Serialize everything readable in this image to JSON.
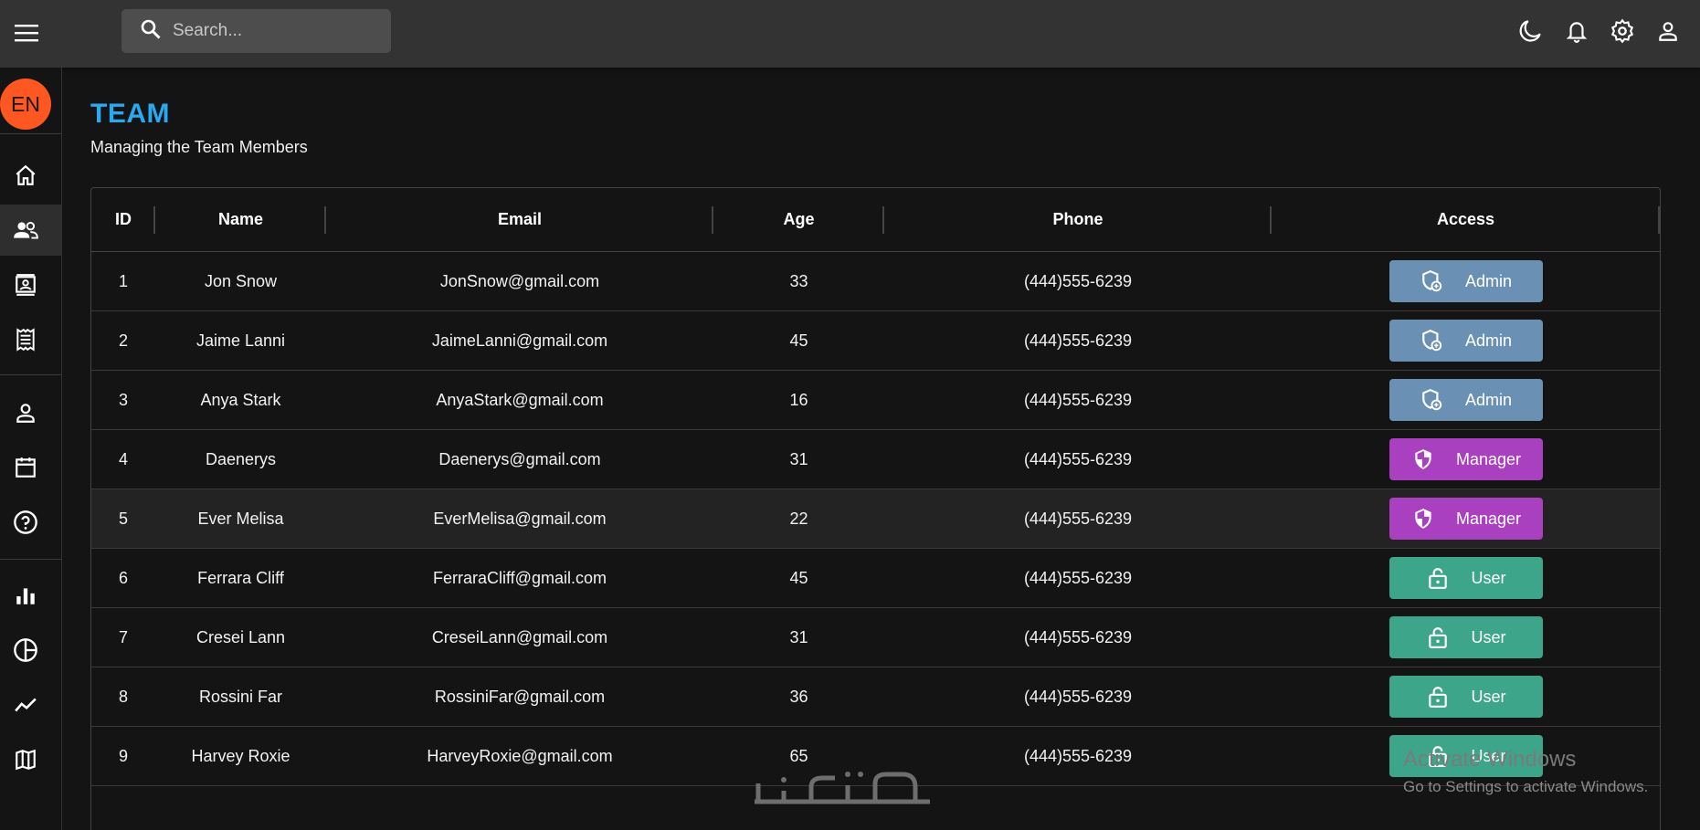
{
  "search": {
    "placeholder": "Search..."
  },
  "sidebar": {
    "language_badge": "EN"
  },
  "page": {
    "title": "TEAM",
    "subtitle": "Managing the Team Members"
  },
  "table": {
    "columns": [
      "ID",
      "Name",
      "Email",
      "Age",
      "Phone",
      "Access"
    ],
    "rows": [
      {
        "id": "1",
        "name": "Jon Snow",
        "email": "JonSnow@gmail.com",
        "age": "33",
        "phone": "(444)555-6239",
        "access": "Admin"
      },
      {
        "id": "2",
        "name": "Jaime Lanni",
        "email": "JaimeLanni@gmail.com",
        "age": "45",
        "phone": "(444)555-6239",
        "access": "Admin"
      },
      {
        "id": "3",
        "name": "Anya Stark",
        "email": "AnyaStark@gmail.com",
        "age": "16",
        "phone": "(444)555-6239",
        "access": "Admin"
      },
      {
        "id": "4",
        "name": "Daenerys",
        "email": "Daenerys@gmail.com",
        "age": "31",
        "phone": "(444)555-6239",
        "access": "Manager"
      },
      {
        "id": "5",
        "name": "Ever Melisa",
        "email": "EverMelisa@gmail.com",
        "age": "22",
        "phone": "(444)555-6239",
        "access": "Manager"
      },
      {
        "id": "6",
        "name": "Ferrara Cliff",
        "email": "FerraraCliff@gmail.com",
        "age": "45",
        "phone": "(444)555-6239",
        "access": "User"
      },
      {
        "id": "7",
        "name": "Cresei Lann",
        "email": "CreseiLann@gmail.com",
        "age": "31",
        "phone": "(444)555-6239",
        "access": "User"
      },
      {
        "id": "8",
        "name": "Rossini Far",
        "email": "RossiniFar@gmail.com",
        "age": "36",
        "phone": "(444)555-6239",
        "access": "User"
      },
      {
        "id": "9",
        "name": "Harvey Roxie",
        "email": "HarveyRoxie@gmail.com",
        "age": "65",
        "phone": "(444)555-6239",
        "access": "User"
      }
    ]
  },
  "access_colors": {
    "Admin": "#6a91b3",
    "Manager": "#a840c0",
    "User": "#3da58a"
  },
  "colors": {
    "accent": "#2aa8f0",
    "language_badge": "#ff5722"
  },
  "overlay": {
    "title": "Activate Windows",
    "subtitle": "Go to Settings to activate Windows."
  }
}
